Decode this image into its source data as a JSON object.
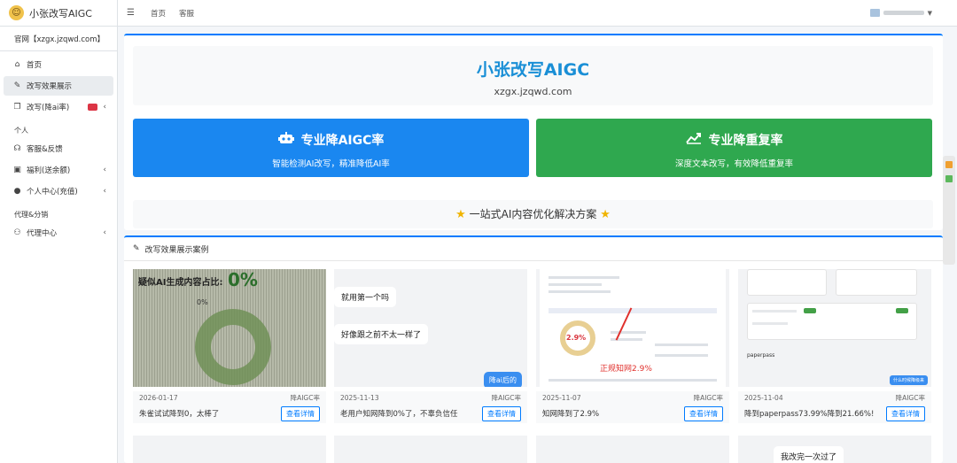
{
  "brand": {
    "title": "小张改写AIGC",
    "logo_icon": "smiling-face-icon"
  },
  "site_url": "官网【xzgx.jzqwd.com】",
  "sidebar": {
    "items": [
      {
        "label": "首页",
        "icon": "home-icon"
      },
      {
        "label": "改写效果展示",
        "icon": "edit-icon",
        "active": true
      },
      {
        "label": "改写(降ai率)",
        "icon": "copy-icon",
        "badge": true,
        "chevron": true
      }
    ],
    "section_personal": "个人",
    "personal_items": [
      {
        "label": "客服&反馈",
        "icon": "headset-icon"
      },
      {
        "label": "福利(送余额)",
        "icon": "gift-icon",
        "chevron": true
      },
      {
        "label": "个人中心(充值)",
        "icon": "user-settings-icon",
        "chevron": true
      }
    ],
    "section_agent": "代理&分销",
    "agent_items": [
      {
        "label": "代理中心",
        "icon": "users-icon",
        "chevron": true
      }
    ]
  },
  "topbar": {
    "links": [
      "首页",
      "客服"
    ]
  },
  "hero": {
    "title": "小张改写AIGC",
    "subtitle": "xzgx.jzqwd.com"
  },
  "features": [
    {
      "title": "专业降AIGC率",
      "subtitle": "智能检测AI改写，精准降低AI率",
      "icon": "robot-icon",
      "color": "#1a87f0"
    },
    {
      "title": "专业降重复率",
      "subtitle": "深度文本改写，有效降低重复率",
      "icon": "chart-line-icon",
      "color": "#2fa84f"
    }
  ],
  "slogan": "一站式AI内容优化解决方案",
  "cases_section": {
    "title": "改写效果展示案例"
  },
  "cases": [
    {
      "date": "2026-01-17",
      "type": "降AIGC率",
      "desc": "朱雀试试降到0，太棒了",
      "button": "查看详情",
      "img_text": "疑似AI生成内容占比:",
      "img_big": "0%",
      "img_small": "0%"
    },
    {
      "date": "2025-11-13",
      "type": "降AIGC率",
      "desc": "老用户知网降到0%了，不辜负信任",
      "button": "查看详情",
      "chat1": "就用第一个吗",
      "chat2": "好像跟之前不太一样了",
      "chat3": "降ai后的"
    },
    {
      "date": "2025-11-07",
      "type": "降AIGC率",
      "desc": "知网降到了2.9%",
      "button": "查看详情",
      "img_pct": "2.9%",
      "img_red": "正规知网2.9%"
    },
    {
      "date": "2025-11-04",
      "type": "降AIGC率",
      "desc": "降到paperpass73.99%降到21.66%!",
      "button": "查看详情",
      "img_paper": "paperpass",
      "img_btn": "什么时候降级来"
    }
  ],
  "row2_last_chat": "我改完一次过了"
}
